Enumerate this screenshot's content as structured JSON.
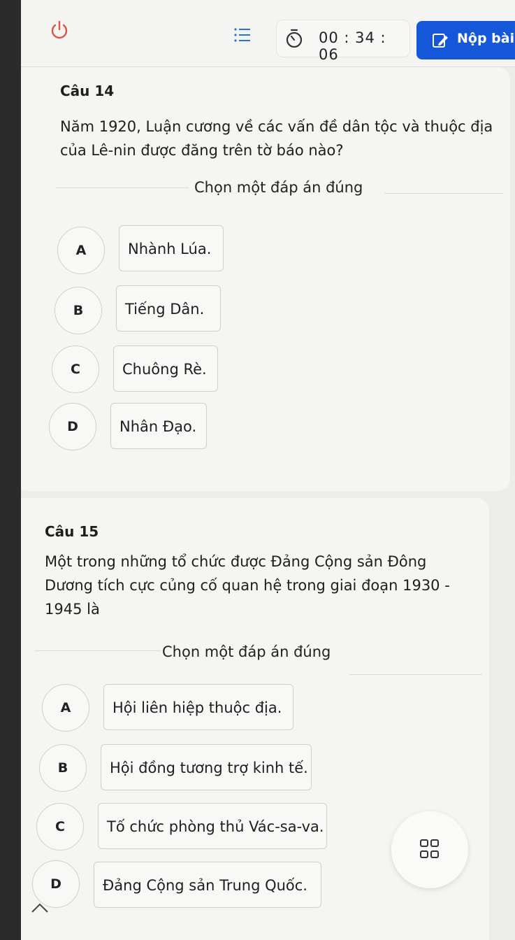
{
  "header": {
    "timer": "00 : 34 : 06",
    "submit_label": "Nộp bài",
    "icons": [
      "power-icon",
      "list-icon",
      "timer-icon",
      "edit-icon"
    ]
  },
  "questions": [
    {
      "number": "Câu 14",
      "text_lines": [
        "Năm 1920, Luận cương về các vấn đề dân tộc và thuộc địa",
        "của Lê-nin được đăng trên tờ báo nào?"
      ],
      "prompt": "Chọn một đáp án đúng",
      "options": [
        {
          "letter": "A",
          "text": "Nhành Lúa."
        },
        {
          "letter": "B",
          "text": "Tiếng Dân."
        },
        {
          "letter": "C",
          "text": "Chuông Rè."
        },
        {
          "letter": "D",
          "text": "Nhân Đạo."
        }
      ]
    },
    {
      "number": "Câu 15",
      "text_lines": [
        "Một trong những tổ chức được Đảng Cộng sản Đông",
        "Dương tích cực củng cố quan hệ trong giai đoạn 1930 -",
        "1945 là"
      ],
      "prompt": "Chọn một đáp án đúng",
      "options": [
        {
          "letter": "A",
          "text": "Hội liên hiệp thuộc địa."
        },
        {
          "letter": "B",
          "text": "Hội đồng tương trợ kinh tế."
        },
        {
          "letter": "C",
          "text": "Tố chức phòng thủ Vác-sa-va."
        },
        {
          "letter": "D",
          "text": "Đảng Cộng sản Trung Quốc."
        }
      ]
    }
  ],
  "colors": {
    "accent": "#1458d9",
    "background": "#ecece8",
    "card": "#f5f5f2"
  }
}
